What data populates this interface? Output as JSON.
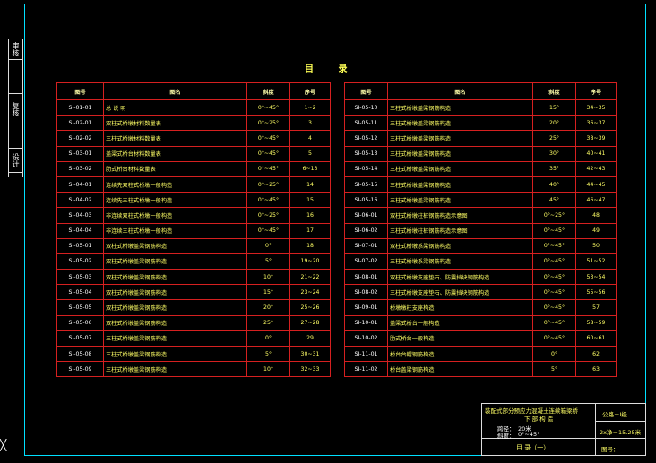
{
  "side_tabs": [
    "审核",
    "复核",
    "设计"
  ],
  "title": "目  录",
  "headers": [
    "图号",
    "图名",
    "斜度",
    "序号"
  ],
  "left_rows": [
    [
      "SI-01-01",
      "总 说 明",
      "0°~45°",
      "1~2"
    ],
    [
      "SI-02-01",
      "双柱式桥墩材料数量表",
      "0°~25°",
      "3"
    ],
    [
      "SI-02-02",
      "三柱式桥墩材料数量表",
      "0°~45°",
      "4"
    ],
    [
      "SI-03-01",
      "盖梁式桥台材料数量表",
      "0°~45°",
      "5"
    ],
    [
      "SI-03-02",
      "肋式桥台材料数量表",
      "0°~45°",
      "6~13"
    ],
    [
      "SI-04-01",
      "连续先双柱式桥墩一般构造",
      "0°~25°",
      "14"
    ],
    [
      "SI-04-02",
      "连续先三柱式桥墩一般构造",
      "0°~45°",
      "15"
    ],
    [
      "SI-04-03",
      "非连续双柱式桥墩一般构造",
      "0°~25°",
      "16"
    ],
    [
      "SI-04-04",
      "非连续三柱式桥墩一般构造",
      "0°~45°",
      "17"
    ],
    [
      "SI-05-01",
      "双柱式桥墩盖梁钢筋构造",
      "0°",
      "18"
    ],
    [
      "SI-05-02",
      "双柱式桥墩盖梁钢筋构造",
      "5°",
      "19~20"
    ],
    [
      "SI-05-03",
      "双柱式桥墩盖梁钢筋构造",
      "10°",
      "21~22"
    ],
    [
      "SI-05-04",
      "双柱式桥墩盖梁钢筋构造",
      "15°",
      "23~24"
    ],
    [
      "SI-05-05",
      "双柱式桥墩盖梁钢筋构造",
      "20°",
      "25~26"
    ],
    [
      "SI-05-06",
      "双柱式桥墩盖梁钢筋构造",
      "25°",
      "27~28"
    ],
    [
      "SI-05-07",
      "三柱式桥墩盖梁钢筋构造",
      "0°",
      "29"
    ],
    [
      "SI-05-08",
      "三柱式桥墩盖梁钢筋构造",
      "5°",
      "30~31"
    ],
    [
      "SI-05-09",
      "三柱式桥墩盖梁钢筋构造",
      "10°",
      "32~33"
    ]
  ],
  "right_rows": [
    [
      "SI-05-10",
      "三柱式桥墩盖梁钢筋构造",
      "15°",
      "34~35"
    ],
    [
      "SI-05-11",
      "三柱式桥墩盖梁钢筋构造",
      "20°",
      "36~37"
    ],
    [
      "SI-05-12",
      "三柱式桥墩盖梁钢筋构造",
      "25°",
      "38~39"
    ],
    [
      "SI-05-13",
      "三柱式桥墩盖梁钢筋构造",
      "30°",
      "40~41"
    ],
    [
      "SI-05-14",
      "三柱式桥墩盖梁钢筋构造",
      "35°",
      "42~43"
    ],
    [
      "SI-05-15",
      "三柱式桥墩盖梁钢筋构造",
      "40°",
      "44~45"
    ],
    [
      "SI-05-16",
      "三柱式桥墩盖梁钢筋构造",
      "45°",
      "46~47"
    ],
    [
      "SI-06-01",
      "双柱式桥墩柱桩钢筋构造示意图",
      "0°~25°",
      "48"
    ],
    [
      "SI-06-02",
      "三柱式桥墩柱桩钢筋构造示意图",
      "0°~45°",
      "49"
    ],
    [
      "SI-07-01",
      "双柱式桥墩系梁钢筋构造",
      "0°~45°",
      "50"
    ],
    [
      "SI-07-02",
      "三柱式桥墩系梁钢筋构造",
      "0°~45°",
      "51~52"
    ],
    [
      "SI-08-01",
      "双柱式桥墩支座垫石、防震挡块钢筋构造",
      "0°~45°",
      "53~54"
    ],
    [
      "SI-08-02",
      "三柱式桥墩支座垫石、防震挡块钢筋构造",
      "0°~45°",
      "55~56"
    ],
    [
      "SI-09-01",
      "桥墩墩柱支座构造",
      "0°~45°",
      "57"
    ],
    [
      "SI-10-01",
      "盖梁式桥台一般构造",
      "0°~45°",
      "58~59"
    ],
    [
      "SI-10-02",
      "肋式桥台一般构造",
      "0°~45°",
      "60~61"
    ],
    [
      "SI-11-01",
      "桥台台帽钢筋构造",
      "0°",
      "62"
    ],
    [
      "SI-11-02",
      "桥台盖梁钢筋构造",
      "5°",
      "63"
    ]
  ],
  "title_block": {
    "project": "装配式部分预应力混凝土连续箱梁桥",
    "project_sub": "下 部 构 造",
    "span_label": "跨径：",
    "span_value": "20米",
    "skew_label": "斜度：",
    "skew_value": "0°~45°",
    "drawing_title": "目 录（一）",
    "load_class": "公路－I级",
    "width_text": "2x净－15.25米",
    "sheet_label": "图号："
  }
}
